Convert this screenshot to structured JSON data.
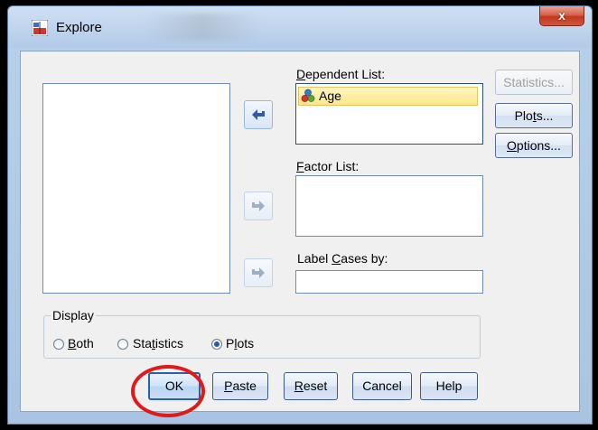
{
  "window": {
    "title": "Explore",
    "close_label": "x"
  },
  "lists": {
    "dependent_label_prefix": "",
    "dependent_label_u": "D",
    "dependent_label_rest": "ependent List:",
    "dependent_items": [
      "Age"
    ],
    "factor_label_u": "F",
    "factor_label_rest": "actor List:",
    "label_cases_prefix": "Label ",
    "label_cases_u": "C",
    "label_cases_rest": "ases by:"
  },
  "side_buttons": {
    "statistics": "Statistics...",
    "plots_a": "Plo",
    "plots_u": "t",
    "plots_b": "s...",
    "options_u": "O",
    "options_rest": "ptions..."
  },
  "display": {
    "title": "Display",
    "options": [
      {
        "u": "B",
        "rest": "oth",
        "checked": false
      },
      {
        "pre": "Sta",
        "u": "t",
        "rest": "istics",
        "checked": false
      },
      {
        "pre": "P",
        "u": "l",
        "rest": "ots",
        "checked": true
      }
    ]
  },
  "bottom_buttons": {
    "ok": "OK",
    "paste_u": "P",
    "paste_rest": "aste",
    "reset_u": "R",
    "reset_rest": "eset",
    "cancel": "Cancel",
    "help": "Help"
  },
  "colors": {
    "annotation_circle": "#e0191b",
    "selected_item": "#fde68a"
  }
}
